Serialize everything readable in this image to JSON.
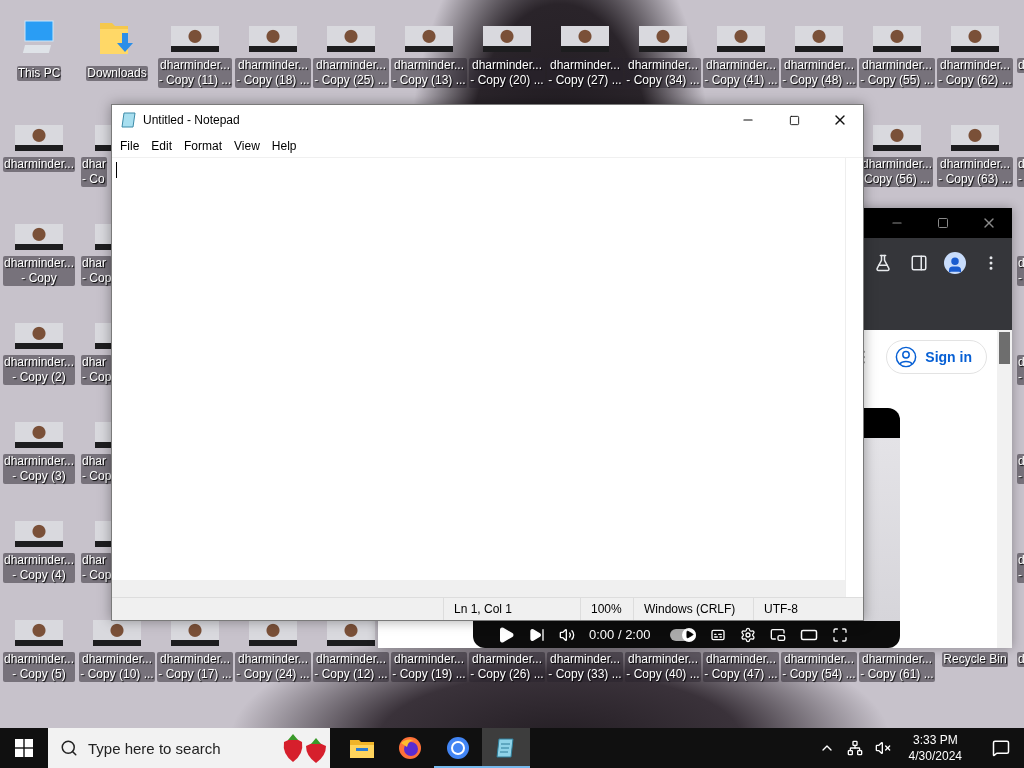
{
  "desktop": {
    "icon_rows": [
      {
        "left": [
          {
            "kind": "computer",
            "lines": [
              "This PC"
            ]
          },
          {
            "kind": "folder",
            "lines": [
              "Downloads"
            ]
          },
          {
            "kind": "photo",
            "lines": [
              "dharminder...",
              "- Copy (11) ..."
            ]
          },
          {
            "kind": "photo",
            "lines": [
              "dharminder...",
              "- Copy (18) ..."
            ]
          },
          {
            "kind": "photo",
            "lines": [
              "dharminder...",
              "- Copy (25) ..."
            ]
          },
          {
            "kind": "photo",
            "lines": [
              "dharminder...",
              "- Copy (13) ..."
            ]
          },
          {
            "kind": "photo",
            "lines": [
              "dharminder...",
              "- Copy (20) ..."
            ]
          },
          {
            "kind": "photo",
            "lines": [
              "dharminder...",
              "- Copy (27) ..."
            ]
          },
          {
            "kind": "photo",
            "lines": [
              "dharminder...",
              "- Copy (34) ..."
            ]
          },
          {
            "kind": "photo",
            "lines": [
              "dharminder...",
              "- Copy (41) ..."
            ]
          },
          {
            "kind": "photo",
            "lines": [
              "dharminder...",
              "- Copy (48) ..."
            ]
          },
          {
            "kind": "photo",
            "lines": [
              "dharminder...",
              "- Copy (55) ..."
            ]
          },
          {
            "kind": "photo",
            "lines": [
              "dharminder...",
              "- Copy (62) ..."
            ]
          },
          {
            "kind": "cut_label",
            "lines": [
              "d"
            ]
          }
        ]
      },
      {
        "left": [
          {
            "kind": "photo",
            "lines": [
              "dharminder..."
            ]
          },
          {
            "kind": "cut_photo",
            "lines": [
              "dhar",
              "- Co"
            ]
          }
        ],
        "right": [
          {
            "kind": "photo",
            "lines": [
              "dharminder...",
              "Copy (56) ..."
            ]
          },
          {
            "kind": "photo",
            "lines": [
              "dharminder...",
              "- Copy (63) ..."
            ]
          },
          {
            "kind": "cut_label",
            "lines": [
              "d",
              "-"
            ]
          }
        ]
      },
      {
        "left": [
          {
            "kind": "photo",
            "lines": [
              "dharminder...",
              "- Copy"
            ]
          },
          {
            "kind": "cut_photo",
            "lines": [
              "dhar",
              "- Cop"
            ]
          }
        ],
        "right": [
          {
            "kind": "cut_label",
            "lines": [
              "d",
              "-"
            ]
          }
        ]
      },
      {
        "left": [
          {
            "kind": "photo",
            "lines": [
              "dharminder...",
              "- Copy (2)"
            ]
          },
          {
            "kind": "cut_photo",
            "lines": [
              "dhar",
              "- Cop"
            ]
          }
        ],
        "right": [
          {
            "kind": "cut_label",
            "lines": [
              "d",
              "-"
            ]
          }
        ]
      },
      {
        "left": [
          {
            "kind": "photo",
            "lines": [
              "dharminder...",
              "- Copy (3)"
            ]
          },
          {
            "kind": "cut_photo",
            "lines": [
              "dhar",
              "- Cop"
            ]
          }
        ],
        "right": [
          {
            "kind": "cut_label",
            "lines": [
              "d",
              "-"
            ]
          }
        ]
      },
      {
        "left": [
          {
            "kind": "photo",
            "lines": [
              "dharminder...",
              "- Copy (4)"
            ]
          },
          {
            "kind": "cut_photo",
            "lines": [
              "dhar",
              "- Cop"
            ]
          }
        ],
        "right": [
          {
            "kind": "cut_label",
            "lines": [
              "d",
              "-"
            ]
          }
        ]
      },
      {
        "left": [
          {
            "kind": "photo",
            "lines": [
              "dharminder...",
              "- Copy (5)"
            ]
          },
          {
            "kind": "photo",
            "lines": [
              "dharminder...",
              "- Copy (10) ..."
            ]
          },
          {
            "kind": "photo",
            "lines": [
              "dharminder...",
              "- Copy (17) ..."
            ]
          },
          {
            "kind": "photo",
            "lines": [
              "dharminder...",
              "- Copy (24) ..."
            ]
          },
          {
            "kind": "photo",
            "lines": [
              "dharminder...",
              "- Copy (12) ..."
            ]
          },
          {
            "kind": "label_only",
            "lines": [
              "dharminder...",
              "- Copy (19) ..."
            ]
          },
          {
            "kind": "label_only",
            "lines": [
              "dharminder...",
              "- Copy (26) ..."
            ]
          },
          {
            "kind": "label_only",
            "lines": [
              "dharminder...",
              "- Copy (33) ..."
            ]
          },
          {
            "kind": "label_only",
            "lines": [
              "dharminder...",
              "- Copy (40) ..."
            ]
          },
          {
            "kind": "label_only",
            "lines": [
              "dharminder...",
              "- Copy (47) ..."
            ]
          },
          {
            "kind": "label_only",
            "lines": [
              "dharminder...",
              "- Copy (54) ..."
            ]
          },
          {
            "kind": "label_only",
            "lines": [
              "dharminder...",
              "- Copy (61) ..."
            ]
          },
          {
            "kind": "label_only",
            "lines": [
              "Recycle Bin"
            ]
          },
          {
            "kind": "cut_label",
            "lines": [
              "d"
            ]
          }
        ]
      }
    ]
  },
  "browser": {
    "sign_in": "Sign in",
    "video": {
      "time": "0:00 / 2:00",
      "autoplay": true
    }
  },
  "notepad": {
    "title": "Untitled - Notepad",
    "menu": [
      "File",
      "Edit",
      "Format",
      "View",
      "Help"
    ],
    "status": [
      "Ln 1, Col 1",
      "100%",
      "Windows (CRLF)",
      "UTF-8"
    ]
  },
  "taskbar": {
    "search": {
      "placeholder": "Type here to search"
    },
    "apps": [
      {
        "kind": "explorer",
        "running": false,
        "selected": false
      },
      {
        "kind": "firefox",
        "running": false,
        "selected": false
      },
      {
        "kind": "chrome",
        "running": true,
        "selected": false
      },
      {
        "kind": "notepad",
        "running": true,
        "selected": true
      }
    ],
    "time": "3:33 PM",
    "date": "4/30/2024"
  }
}
